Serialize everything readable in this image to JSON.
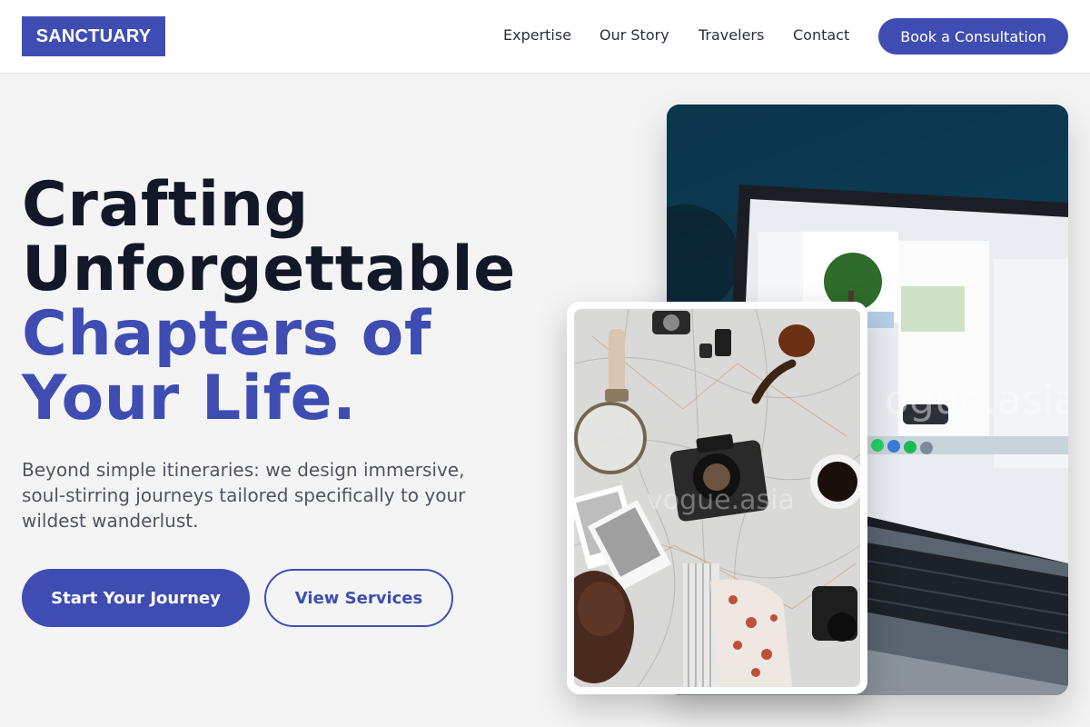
{
  "brand": {
    "logo_text": "SANCTUARY",
    "accent_color": "#3f4db3"
  },
  "nav": {
    "links": [
      "Expertise",
      "Our Story",
      "Travelers",
      "Contact"
    ],
    "cta_label": "Book a Consultation"
  },
  "hero": {
    "headline_dark": [
      "Crafting",
      "Unforgettable"
    ],
    "headline_accent": [
      "Chapters of",
      "Your Life."
    ],
    "subtext": "Beyond simple itineraries: we design immersive, soul-stirring journeys tailored specifically to your wildest wanderlust.",
    "primary_button": "Start Your Journey",
    "secondary_button": "View Services"
  },
  "images": {
    "laptop_photo_watermark": "ogue.asia",
    "map_photo_watermark": "vogue.asia"
  }
}
